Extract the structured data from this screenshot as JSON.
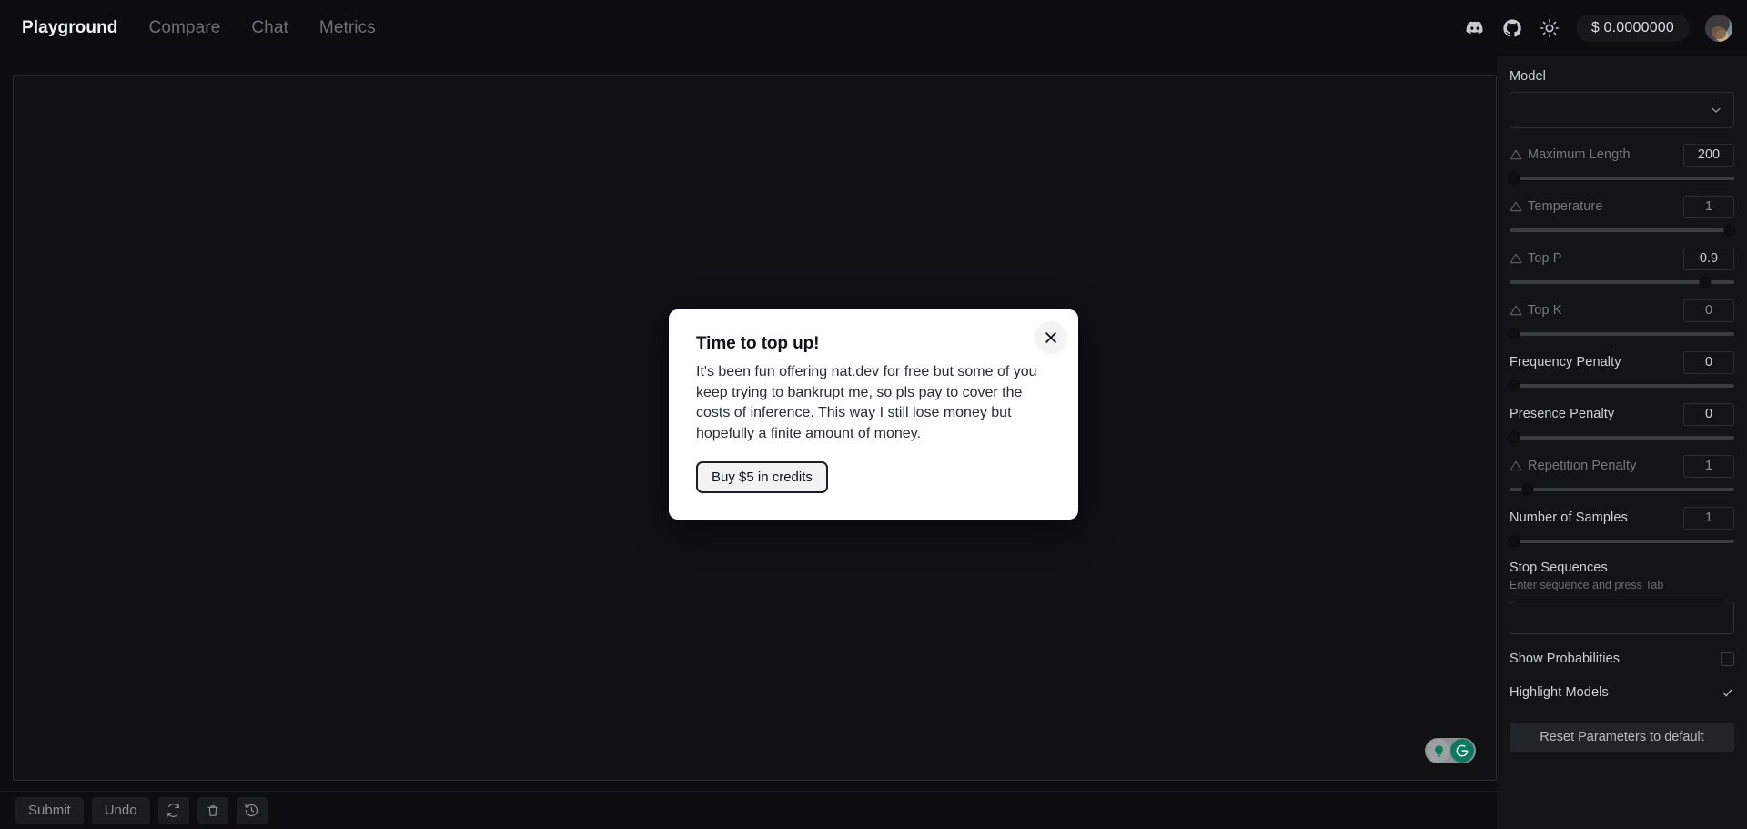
{
  "nav": {
    "links": [
      {
        "label": "Playground",
        "active": true
      },
      {
        "label": "Compare",
        "active": false
      },
      {
        "label": "Chat",
        "active": false
      },
      {
        "label": "Metrics",
        "active": false
      }
    ],
    "icons": [
      "discord-icon",
      "github-icon",
      "sun-icon"
    ],
    "balance": "$ 0.0000000",
    "avatar_name": "user-avatar"
  },
  "editor": {
    "content": "",
    "grammarly": {
      "lamp_icon": "lightbulb-icon",
      "logo_icon": "grammarly-logo-icon"
    }
  },
  "toolbar": {
    "submit_label": "Submit",
    "undo_label": "Undo",
    "regenerate_icon": "refresh-icon",
    "delete_icon": "trash-icon",
    "history_icon": "history-icon"
  },
  "sidebar": {
    "model_label": "Model",
    "model_value": "",
    "chevron_icon": "chevron-down-icon",
    "parameters": [
      {
        "name": "Maximum Length",
        "value": "200",
        "warn": true,
        "fill": 2
      },
      {
        "name": "Temperature",
        "value": "1",
        "warn": true,
        "fill": 98
      },
      {
        "name": "Top P",
        "value": "0.9",
        "warn": true,
        "fill": 87
      },
      {
        "name": "Top K",
        "value": "0",
        "warn": true,
        "fill": 2
      },
      {
        "name": "Frequency Penalty",
        "value": "0",
        "warn": false,
        "fill": 2
      },
      {
        "name": "Presence Penalty",
        "value": "0",
        "warn": false,
        "fill": 2
      },
      {
        "name": "Repetition Penalty",
        "value": "1",
        "warn": true,
        "fill": 8
      },
      {
        "name": "Number of Samples",
        "value": "1",
        "warn": false,
        "fill": 2
      }
    ],
    "stop_sequences": {
      "label": "Stop Sequences",
      "hint": "Enter sequence and press Tab",
      "value": "",
      "placeholder": ""
    },
    "toggles": [
      {
        "label": "Show Probabilities",
        "checked": false
      },
      {
        "label": "Highlight Models",
        "checked": true
      }
    ],
    "reset_label": "Reset Parameters to default"
  },
  "modal": {
    "title": "Time to top up!",
    "body": "It's been fun offering nat.dev for free but some of you keep trying to bankrupt me, so pls pay to cover the costs of inference. This way I still lose money but hopefully a finite amount of money.",
    "cta_label": "Buy $5 in credits",
    "close_icon": "close-icon"
  },
  "colors": {
    "page_bg": "#0d0d0f",
    "panel_bg": "#141418",
    "editor_bg": "#111114",
    "modal_bg": "#ffffff",
    "accent_text": "#f2f3f5",
    "grammarly_green": "#0c7a5e"
  }
}
